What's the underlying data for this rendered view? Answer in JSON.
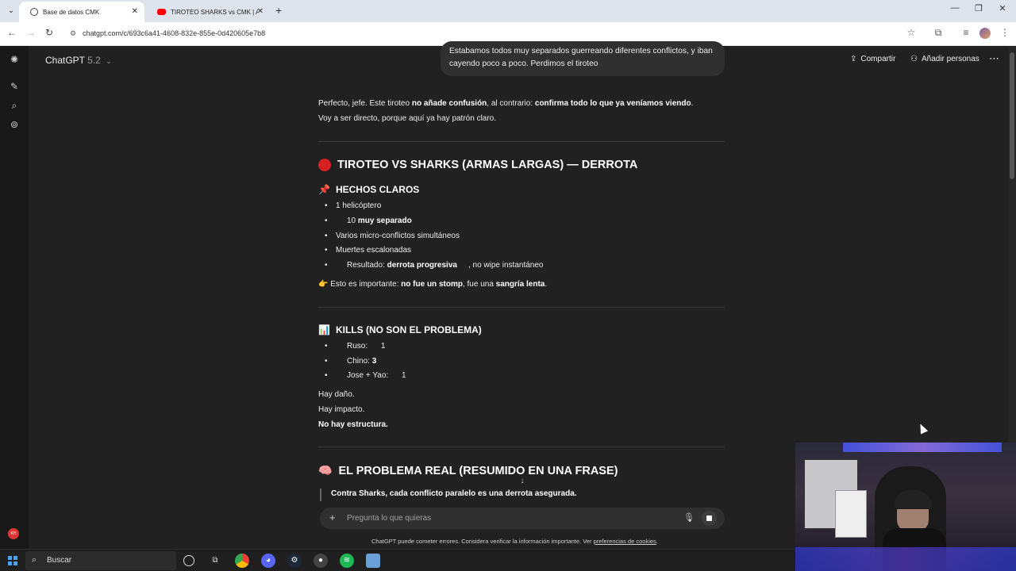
{
  "browser": {
    "tabs": [
      {
        "title": "Base de datos CMK",
        "active": true
      },
      {
        "title": "TIROTEO SHARKS vs CMK | ARM",
        "active": false
      }
    ],
    "url": "chatgpt.com/c/693c6a41-4608-832e-855e-0d420605e7b8"
  },
  "header": {
    "model_name": "ChatGPT",
    "model_version": "5.2",
    "share_label": "Compartir",
    "add_people_label": "Añadir personas"
  },
  "user_message": "Estabamos todos muy separados guerreando diferentes conflictos, y iban cayendo poco a poco. Perdimos el tiroteo",
  "response": {
    "intro_1a": "Perfecto, jefe. Este tiroteo ",
    "intro_1b": "no añade confusión",
    "intro_1c": ", al contrario: ",
    "intro_1d": "confirma todo lo que ya veníamos viendo",
    "intro_1e": ".",
    "intro_2": "Voy a ser directo, porque aquí ya hay patrón claro.",
    "title": "TIROTEO VS SHARKS (ARMAS LARGAS) — DERROTA",
    "facts_heading": "HECHOS CLAROS",
    "facts": [
      {
        "text": "1 helicóptero",
        "bold": ""
      },
      {
        "text": "10 ",
        "bold": "muy separado"
      },
      {
        "text": "Varios micro-conflictos simultáneos",
        "bold": ""
      },
      {
        "text": "Muertes escalonadas",
        "bold": ""
      },
      {
        "text": "Resultado: ",
        "bold": "derrota progresiva",
        "after": ", no wipe instantáneo"
      }
    ],
    "note_a": "Esto es importante: ",
    "note_b": "no fue un stomp",
    "note_c": ", fue una ",
    "note_d": "sangría lenta",
    "note_e": ".",
    "kills_heading": "KILLS (NO SON EL PROBLEMA)",
    "kills": [
      {
        "label": "Ruso: ",
        "value": "1"
      },
      {
        "label": "Chino: ",
        "value": "3"
      },
      {
        "label": "Jose + Yao: ",
        "value": "1"
      }
    ],
    "line_dano": "Hay daño.",
    "line_impacto": "Hay impacto.",
    "line_estructura": "No hay estructura.",
    "problem_heading": "EL PROBLEMA REAL (RESUMIDO EN UNA FRASE)",
    "quote": "Contra Sharks, cada conflicto paralelo es una derrota asegurada."
  },
  "composer": {
    "placeholder": "Pregunta lo que quieras"
  },
  "disclaimer": {
    "text": "ChatGPT puede cometer errores. Considera verificar la información importante. Ver ",
    "link": "preferencias de cookies",
    "end": "."
  },
  "taskbar": {
    "search_label": "Buscar"
  },
  "icons": {
    "facts": "pushpin-icon",
    "kills": "bar-chart-icon",
    "problem": "brain-icon",
    "note": "pointing-hand-icon"
  },
  "colors": {
    "background": "#212121",
    "accent_red": "#d72020"
  }
}
